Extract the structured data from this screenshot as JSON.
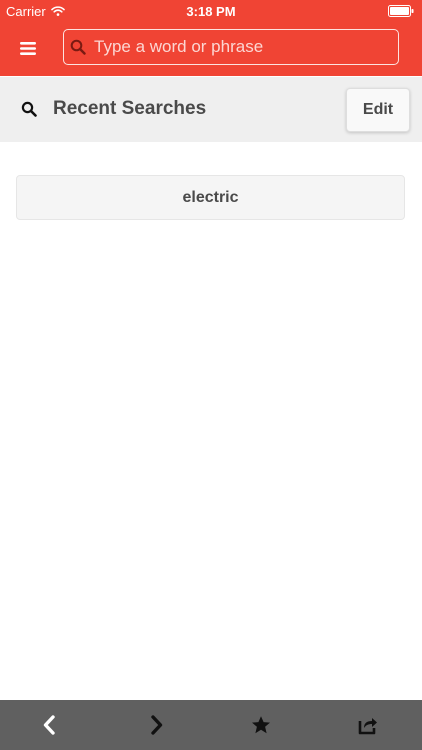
{
  "status_bar": {
    "carrier": "Carrier",
    "time": "3:18 PM"
  },
  "header": {
    "search_placeholder": "Type a word or phrase",
    "accent_color": "#f04434"
  },
  "recent": {
    "title": "Recent Searches",
    "edit_label": "Edit",
    "items": [
      "electric"
    ]
  },
  "toolbar": {
    "icons": [
      "back-icon",
      "forward-icon",
      "star-icon",
      "share-icon"
    ],
    "background_color": "#606060"
  }
}
